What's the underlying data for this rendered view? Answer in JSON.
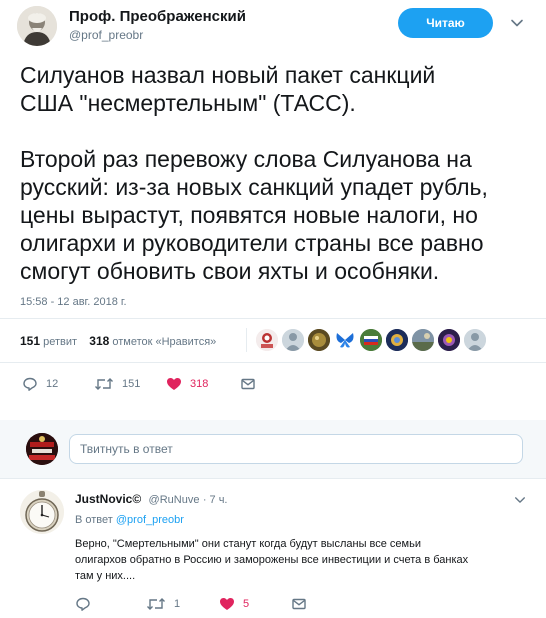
{
  "tweet": {
    "author_name": "Проф. Преображенский",
    "author_handle": "@prof_preobr",
    "follow_label": "Читаю",
    "text_lines": [
      "Силуанов назвал новый пакет санкций",
      "США \"несмертельным\" (ТАСС).",
      "",
      "Второй раз перевожу слова Силуанова на",
      "русский: из-за новых санкций упадет рубль,",
      "цены вырастут, появятся новые налоги, но",
      "олигархи и руководители страны все равно",
      "смогут обновить свои яхты и особняки."
    ],
    "timestamp": "15:58 - 12 авг. 2018 г.",
    "retweets_count": "151",
    "retweets_label": "ретвит",
    "likes_count": "318",
    "likes_label": "отметок «Нравится»",
    "actions": {
      "replies": "12",
      "retweets": "151",
      "likes": "318"
    }
  },
  "compose": {
    "placeholder": "Твитнуть в ответ"
  },
  "reply": {
    "author_name": "JustNovic©",
    "author_handle": "@RuNuve",
    "time": "· 7 ч.",
    "in_reply_prefix": "В ответ",
    "in_reply_handle": "@prof_preobr",
    "text_lines": [
      "Верно, \"Смертельными\" они станут когда будут высланы все семьи",
      "олигархов обратно в Россию и заморожены все инвестиции и счета в банках",
      "там у них...."
    ],
    "actions": {
      "replies": "",
      "retweets": "1",
      "likes": "5"
    }
  },
  "colors": {
    "accent": "#1da1f2",
    "like": "#e0245e",
    "muted": "#657786"
  }
}
